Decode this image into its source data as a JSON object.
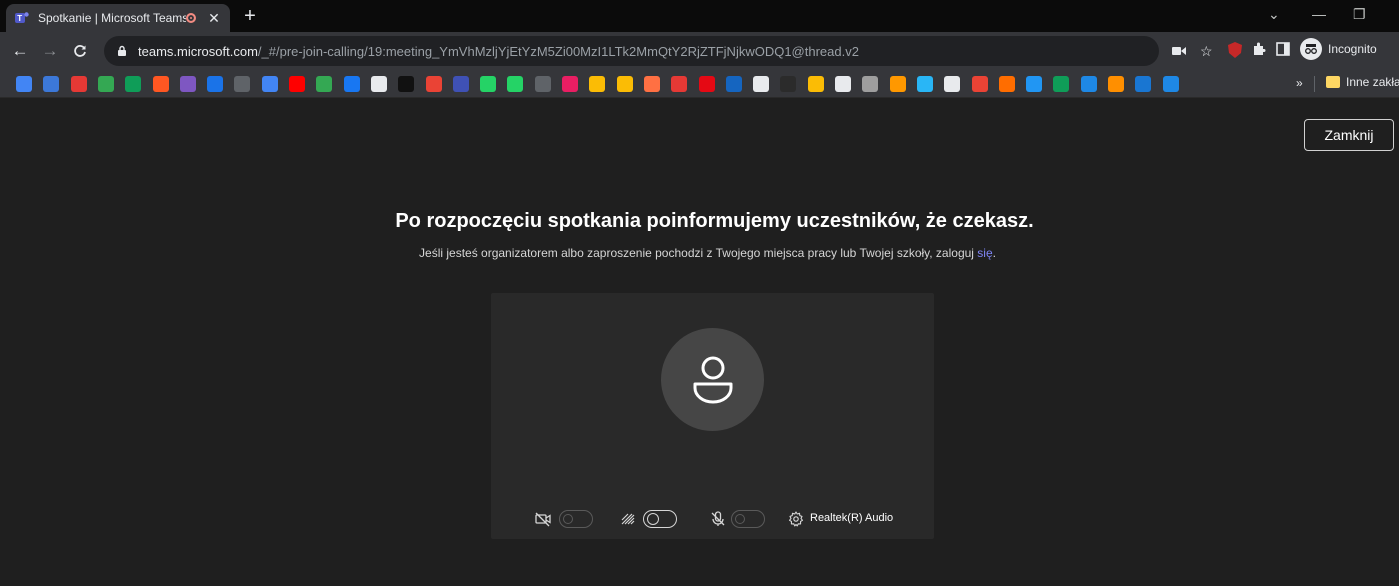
{
  "browser": {
    "tab": {
      "title": "Spotkanie | Microsoft Teams",
      "close": "✕"
    },
    "new_tab": "+",
    "window_controls": {
      "minimize": "—",
      "restore": "❐",
      "collapse": "⌄"
    },
    "address": {
      "host": "teams.microsoft.com",
      "path": "/_#/pre-join-calling/19:meeting_YmVhMzljYjEtYzM5Zi00MzI1LTk2MmQtY2RjZTFjNjkwODQ1@thread.v2"
    },
    "incognito_label": "Incognito",
    "bookmarks_more": "»",
    "bookmarks_folder": "Inne zakładki",
    "bookmark_colors": [
      "#4285f4",
      "#3c78d8",
      "#e53935",
      "#34a853",
      "#0f9d58",
      "#ff5722",
      "#7e57c2",
      "#1a73e8",
      "#5f6368",
      "#4285f4",
      "#ff0000",
      "#34a853",
      "#1877f2",
      "#e8eaed",
      "#111111",
      "#ea4335",
      "#3f51b5",
      "#25d366",
      "#25d366",
      "#5f6368",
      "#e91e63",
      "#fbbc05",
      "#fbbc05",
      "#ff7043",
      "#e53935",
      "#e50914",
      "#1565c0",
      "#e8eaed",
      "#2b2b2b",
      "#fbbc05",
      "#e8eaed",
      "#9e9e9e",
      "#ff9800",
      "#29b6f6",
      "#e8eaed",
      "#ea4335",
      "#ff6d00",
      "#2196f3",
      "#0f9d58",
      "#1e88e5",
      "#ff8f00",
      "#1976d2",
      "#1e88e5"
    ]
  },
  "page": {
    "close_button": "Zamknij",
    "headline": "Po rozpoczęciu spotkania poinformujemy uczestników, że czekasz.",
    "subline_prefix": "Jeśli jesteś organizatorem albo zaproszenie pochodzi z Twojego miejsca pracy lub Twojej szkoły, zaloguj ",
    "subline_link": "się",
    "subline_suffix": ".",
    "audio_device": "Realtek(R) Audio"
  }
}
